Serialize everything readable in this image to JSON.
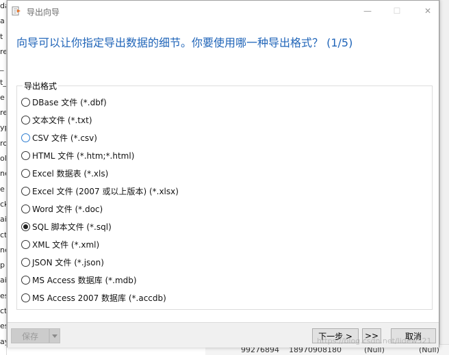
{
  "window": {
    "title": "导出向导",
    "minimize_glyph": "—",
    "maximize_glyph": "☐",
    "close_glyph": "✕"
  },
  "heading": "向导可以让你指定导出数据的细节。你要使用哪一种导出格式？ (1/5)",
  "format_group": {
    "label": "导出格式",
    "selected": "SQL 脚本文件 (*.sql)",
    "options": [
      "DBase 文件 (*.dbf)",
      "文本文件 (*.txt)",
      "CSV 文件 (*.csv)",
      "HTML 文件 (*.htm;*.html)",
      "Excel 数据表 (*.xls)",
      "Excel 文件 (2007 或以上版本) (*.xlsx)",
      "Word 文件 (*.doc)",
      "SQL 脚本文件 (*.sql)",
      "XML 文件 (*.xml)",
      "JSON 文件 (*.json)",
      "MS Access 数据库 (*.mdb)",
      "MS Access 2007 数据库 (*.accdb)"
    ]
  },
  "footer": {
    "save_label": "保存",
    "next_label": "下一步 >",
    "skip_label": ">>",
    "cancel_label": "取消"
  },
  "watermark": "https://blog.csdn.net/lidew521",
  "background": {
    "left_fragments": [
      "da",
      "a",
      "t",
      "re",
      "_",
      "t_",
      "e",
      "re",
      "yp",
      "ro",
      "ol",
      "ne",
      "e",
      "ck",
      "ai",
      "ct",
      "ne",
      "p",
      "ai",
      "es",
      "ct",
      "es",
      "ay"
    ],
    "bottom_fragments": [
      "99276894",
      "18970908180",
      "(Null)",
      "(Null)"
    ]
  },
  "colors": {
    "heading": "#1f64b8",
    "title_icon": "#e8742a"
  }
}
